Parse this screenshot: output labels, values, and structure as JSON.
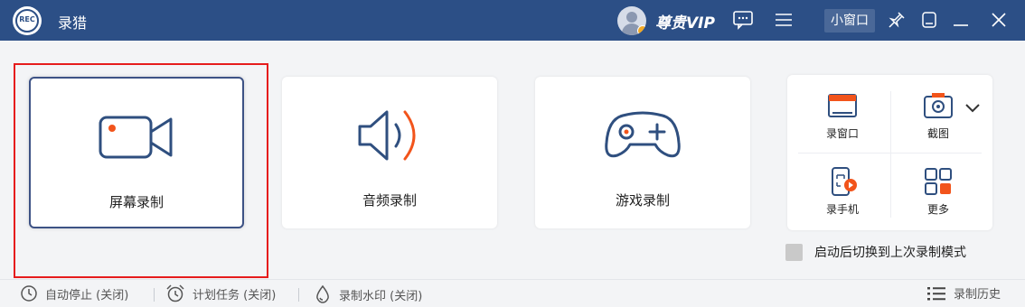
{
  "titlebar": {
    "logo_text": "REC",
    "app_name": "录猎",
    "vip_label": "尊贵VIP",
    "mini_window": "小窗口",
    "icons": [
      "message-icon",
      "menu-icon",
      "pin-icon",
      "skin-icon",
      "minimize-icon",
      "close-icon"
    ]
  },
  "modes": [
    {
      "label": "屏幕录制",
      "icon": "camera-icon",
      "active": true
    },
    {
      "label": "音频录制",
      "icon": "speaker-icon",
      "active": false
    },
    {
      "label": "游戏录制",
      "icon": "gamepad-icon",
      "active": false
    }
  ],
  "tools": {
    "window_record": "录窗口",
    "screenshot": "截图",
    "phone_record": "录手机",
    "more": "更多"
  },
  "restore_label": "启动后切换到上次录制模式",
  "bottom": {
    "auto_stop": "自动停止 (关闭)",
    "schedule": "计划任务 (关闭)",
    "watermark": "录制水印 (关闭)",
    "history": "录制历史"
  },
  "colors": {
    "titlebar": "#2c4f86",
    "accent_orange": "#f2541b",
    "highlight_red": "#e61c1c",
    "icon_stroke": "#2f4f7f"
  }
}
